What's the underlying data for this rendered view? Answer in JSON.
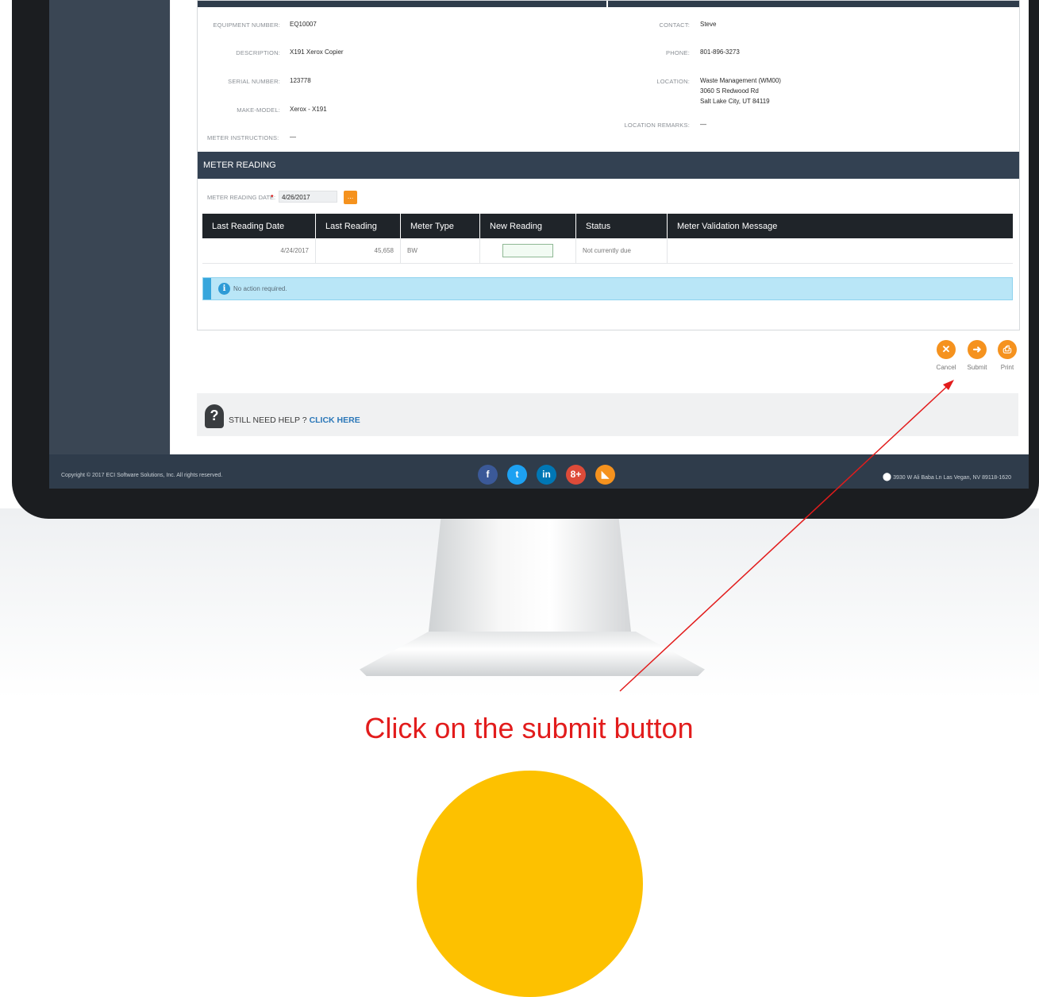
{
  "equipment": {
    "labels": {
      "equipment_number": "EQUIPMENT NUMBER:",
      "description": "DESCRIPTION:",
      "serial_number": "SERIAL NUMBER:",
      "make_model": "MAKE-MODEL:",
      "meter_instructions": "METER INSTRUCTIONS:",
      "contact": "CONTACT:",
      "phone": "PHONE:",
      "location": "LOCATION:",
      "location_remarks": "LOCATION REMARKS:"
    },
    "values": {
      "equipment_number": "EQ10007",
      "description": "X191 Xerox Copier",
      "serial_number": "123778",
      "make_model": "Xerox - X191",
      "meter_instructions": "—",
      "contact": "Steve",
      "phone": "801-896-3273",
      "location_line1": "Waste Management (WM00)",
      "location_line2": "3060 S Redwood Rd",
      "location_line3": "Salt Lake City, UT 84119",
      "location_remarks": "—"
    }
  },
  "meter_section": {
    "title": "METER READING",
    "date_label": "METER READING DATE:",
    "date_value": "4/26/2017",
    "calendar_button": "...",
    "table": {
      "headers": [
        "Last Reading Date",
        "Last Reading",
        "Meter Type",
        "New Reading",
        "Status",
        "Meter Validation Message"
      ],
      "rows": [
        {
          "last_reading_date": "4/24/2017",
          "last_reading": "45,658",
          "meter_type": "BW",
          "new_reading": "",
          "status": "Not currently due",
          "message": ""
        }
      ]
    },
    "alert_text": "No action required."
  },
  "actions": {
    "cancel": "Cancel",
    "submit": "Submit",
    "print": "Print"
  },
  "help": {
    "text": "STILL NEED HELP ?",
    "link": "CLICK HERE"
  },
  "footer": {
    "copyright": "Copyright © 2017 ECI Software Solutions, Inc. All rights reserved.",
    "address": "3930 W Ali Baba Ln Las Vegan, NV 89118-1620",
    "socials": [
      {
        "name": "facebook-icon",
        "glyph": "f",
        "color": "#3b5998"
      },
      {
        "name": "twitter-icon",
        "glyph": "t",
        "color": "#1da1f2"
      },
      {
        "name": "linkedin-icon",
        "glyph": "in",
        "color": "#0077b5"
      },
      {
        "name": "google-plus-icon",
        "glyph": "8+",
        "color": "#dd4b39"
      },
      {
        "name": "rss-icon",
        "glyph": "◣",
        "color": "#f5921e"
      }
    ]
  },
  "instruction": "Click on the submit button",
  "colors": {
    "accent": "#f5921e",
    "annotation": "#e21c1c",
    "header": "#334152"
  }
}
